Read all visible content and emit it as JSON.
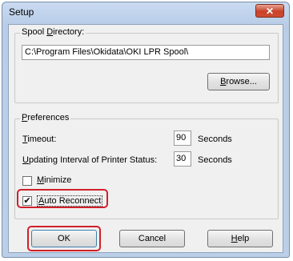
{
  "window": {
    "title": "Setup",
    "close_glyph": "✕"
  },
  "spool_directory": {
    "legend_prefix": "Spool ",
    "legend_hotkey": "D",
    "legend_rest": "irectory:",
    "path_value": "C:\\Program Files\\Okidata\\OKI LPR Spool\\",
    "browse_hotkey": "B",
    "browse_rest": "rowse..."
  },
  "preferences": {
    "legend_prefix": "",
    "legend_hotkey": "P",
    "legend_rest": "references",
    "timeout": {
      "label_hotkey": "T",
      "label_rest": "imeout:",
      "value": "90",
      "unit": "Seconds"
    },
    "update_interval": {
      "label_hotkey": "U",
      "label_rest": "pdating Interval of Printer Status:",
      "value": "30",
      "unit": "Seconds"
    },
    "minimize": {
      "label_hotkey": "M",
      "label_rest": "inimize",
      "checked": false
    },
    "auto_reconnect": {
      "label_hotkey": "A",
      "label_rest": "uto Reconnect",
      "checked": true,
      "check_glyph": "✔"
    }
  },
  "buttons": {
    "ok_label": "OK",
    "cancel_label": "Cancel",
    "help_hotkey": "H",
    "help_rest": "elp"
  },
  "colors": {
    "highlight": "#d0202a"
  }
}
